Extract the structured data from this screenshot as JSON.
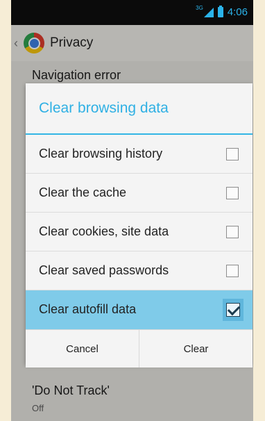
{
  "status": {
    "network": "3G",
    "time": "4:06"
  },
  "header": {
    "title": "Privacy"
  },
  "background_items": {
    "nav_error": "Navigation error",
    "dnt_title": "'Do Not Track'",
    "dnt_value": "Off"
  },
  "dialog": {
    "title": "Clear browsing data",
    "options": [
      {
        "label": "Clear browsing history",
        "checked": false
      },
      {
        "label": "Clear the cache",
        "checked": false
      },
      {
        "label": "Clear cookies, site data",
        "checked": false
      },
      {
        "label": "Clear saved passwords",
        "checked": false
      },
      {
        "label": "Clear autofill data",
        "checked": true
      }
    ],
    "cancel_label": "Cancel",
    "clear_label": "Clear"
  },
  "colors": {
    "accent": "#33b5e5",
    "selected_row": "#7fcbe9"
  },
  "icons": {
    "app_icon": "chrome-icon",
    "back": "back-caret-icon"
  }
}
